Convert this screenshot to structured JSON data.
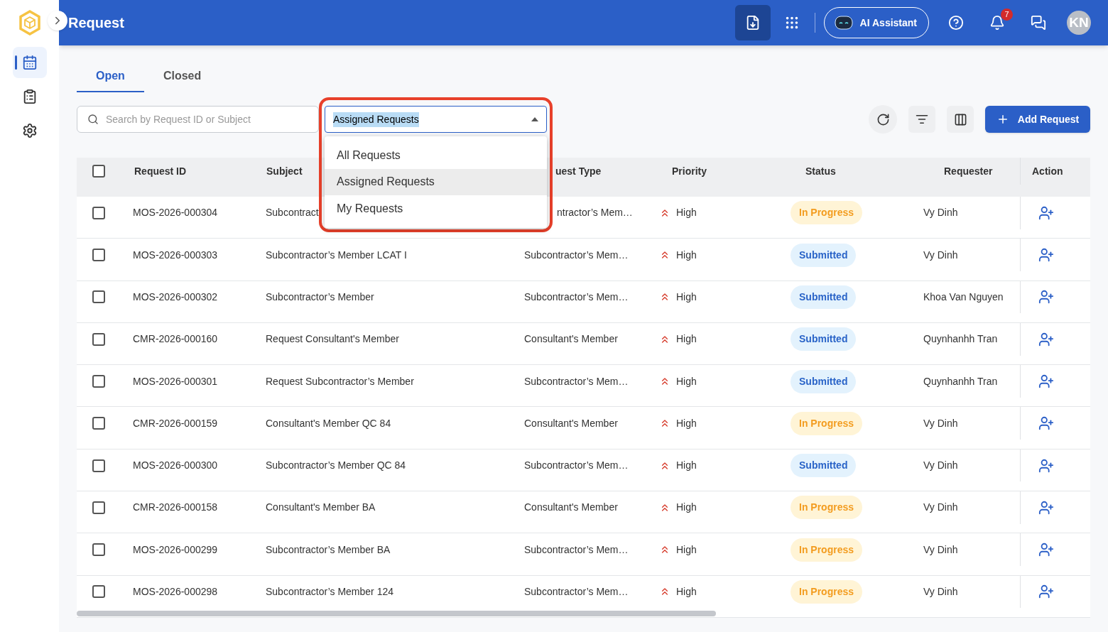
{
  "header": {
    "title": "Request",
    "ai_button": "AI Assistant",
    "notification_count": "7",
    "avatar": "KN"
  },
  "sidebar": {
    "items": [
      {
        "selected": true
      },
      {
        "selected": false
      },
      {
        "selected": false
      }
    ]
  },
  "tabs": [
    {
      "label": "Open",
      "selected": true
    },
    {
      "label": "Closed",
      "selected": false
    }
  ],
  "search": {
    "placeholder": "Search by Request ID or Subject"
  },
  "filter_select": {
    "value": "Assigned Requests",
    "expanded": true,
    "options": [
      {
        "label": "All Requests",
        "selected": false
      },
      {
        "label": "Assigned Requests",
        "selected": true
      },
      {
        "label": "My Requests",
        "selected": false
      }
    ]
  },
  "add_button": "Add Request",
  "table": {
    "select_all_checked": false,
    "columns": [
      "Request ID",
      "Subject",
      "uest Type",
      "Priority",
      "Status",
      "Requester",
      "Action"
    ],
    "rows": [
      {
        "checked": false,
        "id": "MOS-2026-000304",
        "subject": "Subcontract",
        "type": "ntractor’s Mem…",
        "priority": "High",
        "status": {
          "label": "In Progress",
          "kind": "in_progress"
        },
        "requester": "Vy Dinh"
      },
      {
        "checked": false,
        "id": "MOS-2026-000303",
        "subject": "Subcontractor’s Member LCAT I",
        "type": "Subcontractor’s Mem…",
        "priority": "High",
        "status": {
          "label": "Submitted",
          "kind": "submitted"
        },
        "requester": "Vy Dinh"
      },
      {
        "checked": false,
        "id": "MOS-2026-000302",
        "subject": "Subcontractor’s Member",
        "type": "Subcontractor’s Mem…",
        "priority": "High",
        "status": {
          "label": "Submitted",
          "kind": "submitted"
        },
        "requester": "Khoa Van Nguyen"
      },
      {
        "checked": false,
        "id": "CMR-2026-000160",
        "subject": "Request Consultant's Member",
        "type": "Consultant's Member",
        "priority": "High",
        "status": {
          "label": "Submitted",
          "kind": "submitted"
        },
        "requester": "Quynhanhh Tran"
      },
      {
        "checked": false,
        "id": "MOS-2026-000301",
        "subject": "Request Subcontractor’s Member",
        "type": "Subcontractor’s Mem…",
        "priority": "High",
        "status": {
          "label": "Submitted",
          "kind": "submitted"
        },
        "requester": "Quynhanhh Tran"
      },
      {
        "checked": false,
        "id": "CMR-2026-000159",
        "subject": "Consultant's Member QC 84",
        "type": "Consultant's Member",
        "priority": "High",
        "status": {
          "label": "In Progress",
          "kind": "in_progress"
        },
        "requester": "Vy Dinh"
      },
      {
        "checked": false,
        "id": "MOS-2026-000300",
        "subject": "Subcontractor’s Member QC 84",
        "type": "Subcontractor’s Mem…",
        "priority": "High",
        "status": {
          "label": "Submitted",
          "kind": "submitted"
        },
        "requester": "Vy Dinh"
      },
      {
        "checked": false,
        "id": "CMR-2026-000158",
        "subject": "Consultant's Member BA",
        "type": "Consultant's Member",
        "priority": "High",
        "status": {
          "label": "In Progress",
          "kind": "in_progress"
        },
        "requester": "Vy Dinh"
      },
      {
        "checked": false,
        "id": "MOS-2026-000299",
        "subject": "Subcontractor’s Member BA",
        "type": "Subcontractor’s Mem…",
        "priority": "High",
        "status": {
          "label": "In Progress",
          "kind": "in_progress"
        },
        "requester": "Vy Dinh"
      },
      {
        "checked": false,
        "id": "MOS-2026-000298",
        "subject": "Subcontractor’s Member 124",
        "type": "Subcontractor’s Mem…",
        "priority": "High",
        "status": {
          "label": "In Progress",
          "kind": "in_progress"
        },
        "requester": "Vy Dinh"
      }
    ]
  }
}
